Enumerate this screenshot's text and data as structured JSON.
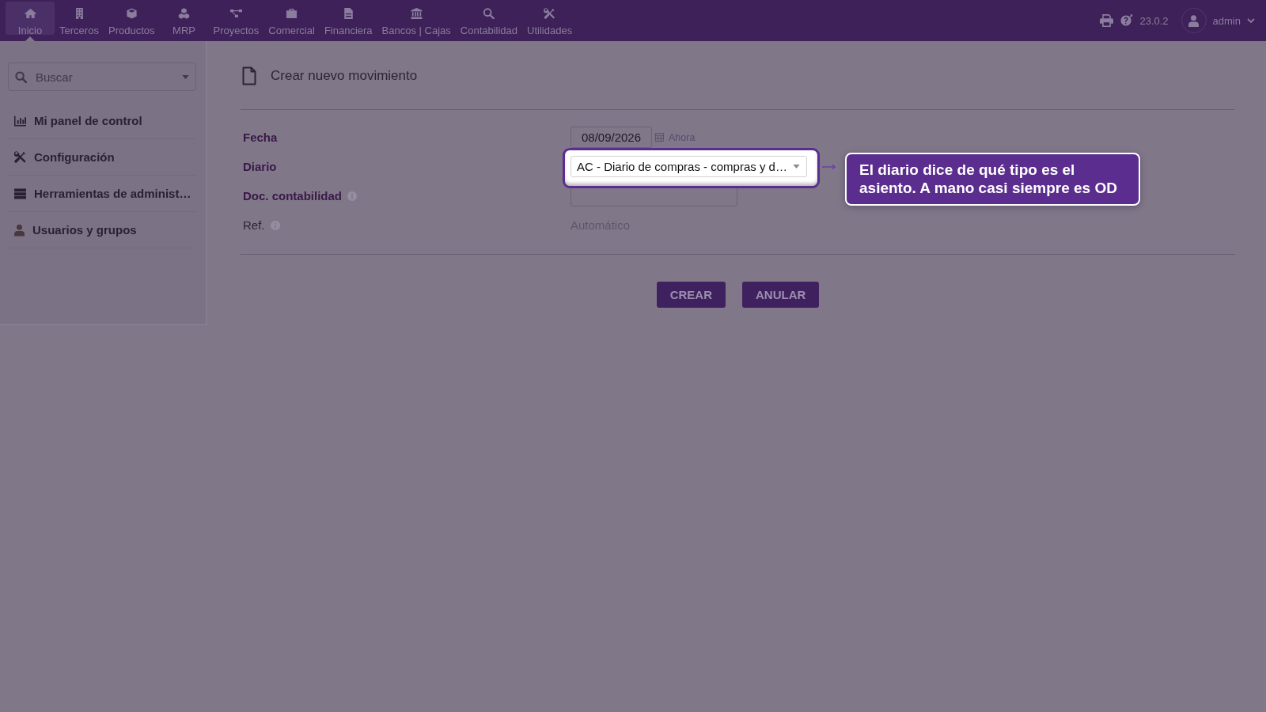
{
  "top_nav": {
    "items": [
      {
        "label": "Inicio",
        "selected": true
      },
      {
        "label": "Terceros",
        "selected": false
      },
      {
        "label": "Productos",
        "selected": false
      },
      {
        "label": "MRP",
        "selected": false
      },
      {
        "label": "Proyectos",
        "selected": false
      },
      {
        "label": "Comercial",
        "selected": false
      },
      {
        "label": "Financiera",
        "selected": false
      },
      {
        "label": "Bancos | Cajas",
        "selected": false
      },
      {
        "label": "Contabilidad",
        "selected": false
      },
      {
        "label": "Utilidades",
        "selected": false
      }
    ],
    "version": "23.0.2",
    "user": "admin"
  },
  "sidebar": {
    "search": {
      "placeholder": "Buscar"
    },
    "items": [
      {
        "label": "Mi panel de control"
      },
      {
        "label": "Configuración"
      },
      {
        "label": "Herramientas de administ…"
      },
      {
        "label": "Usuarios y grupos"
      }
    ]
  },
  "page": {
    "title": "Crear nuevo movimiento"
  },
  "form": {
    "fields": [
      {
        "label": "Fecha",
        "kind": "date",
        "required": true,
        "info": false,
        "value": "08/09/2026",
        "action": "Ahora",
        "spotlight": false
      },
      {
        "label": "Diario",
        "kind": "select",
        "required": true,
        "info": false,
        "value": "AC - Diario de compras - compras y d…",
        "spotlight": true
      },
      {
        "label": "Doc. contabilidad",
        "kind": "text",
        "required": true,
        "info": true,
        "spotlight": false
      },
      {
        "label": "Ref.",
        "kind": "static",
        "required": false,
        "info": true,
        "value": "Automático",
        "spotlight": false
      }
    ]
  },
  "buttons": [
    {
      "label": "CREAR"
    },
    {
      "label": "ANULAR"
    }
  ],
  "tour": {
    "text": "El diario dice de qué tipo es el asiento. A mano casi siempre es OD"
  }
}
